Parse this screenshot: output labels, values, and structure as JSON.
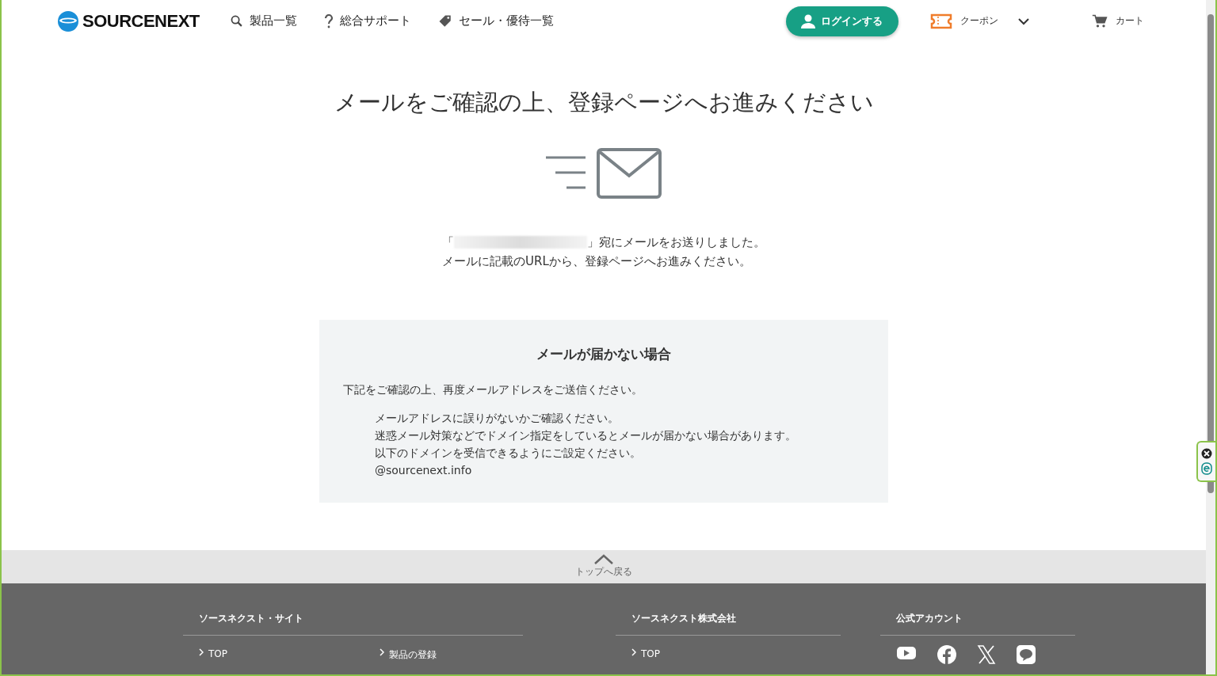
{
  "header": {
    "logo": "SOURCENEXT",
    "nav": [
      {
        "kind": "search",
        "label": "製品一覧"
      },
      {
        "kind": "help",
        "label": "総合サポート"
      },
      {
        "kind": "tag",
        "label": "セール・優待一覧"
      }
    ],
    "login": "ログインする",
    "coupon": "クーポン",
    "cart": "カート"
  },
  "main": {
    "title": "メールをご確認の上、登録ページへお進みください",
    "sent_open": "「",
    "sent_close": "」宛にメールをお送りしました。",
    "instruction": "メールに記載のURLから、登録ページへお進みください。"
  },
  "notice": {
    "heading": "メールが届かない場合",
    "intro": "下記をご確認の上、再度メールアドレスをご送信ください。",
    "items": [
      "メールアドレスに誤りがないかご確認ください。",
      "迷惑メール対策などでドメイン指定をしているとメールが届かない場合があります。",
      "以下のドメインを受信できるようにご設定ください。"
    ],
    "domain": "@sourcenext.info"
  },
  "back_to_top": "トップへ戻る",
  "footer": {
    "columns": [
      {
        "title": "ソースネクスト・サイト",
        "links": [
          "TOP",
          "製品の登録"
        ]
      },
      {
        "title": "ソースネクスト株式会社",
        "links": [
          "TOP"
        ]
      }
    ],
    "social_title": "公式アカウント",
    "social": [
      {
        "kind": "youtube"
      },
      {
        "kind": "facebook"
      },
      {
        "kind": "x"
      },
      {
        "kind": "line"
      }
    ]
  }
}
